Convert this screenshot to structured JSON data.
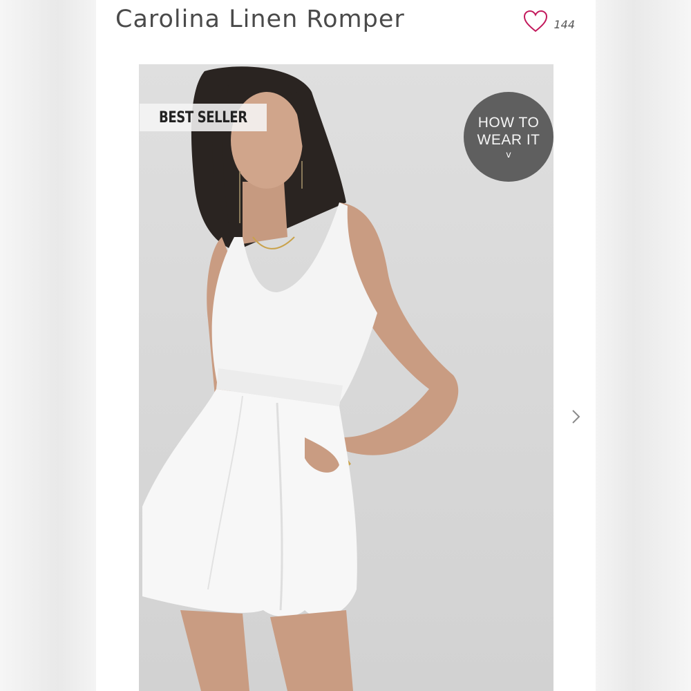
{
  "product": {
    "title": "Carolina Linen Romper",
    "like_count": "144"
  },
  "icons": {
    "favorite": "heart-outline-icon",
    "next": "chevron-right-icon",
    "expand": "chevron-down-icon"
  },
  "image": {
    "badge": "BEST SELLER",
    "how_to_line1": "HOW TO",
    "how_to_line2": "WEAR IT",
    "how_to_chevron": "v"
  },
  "colors": {
    "heart": "#c2185b",
    "how_to_bg": "#5f5f5f",
    "title": "#4a4a4a"
  }
}
